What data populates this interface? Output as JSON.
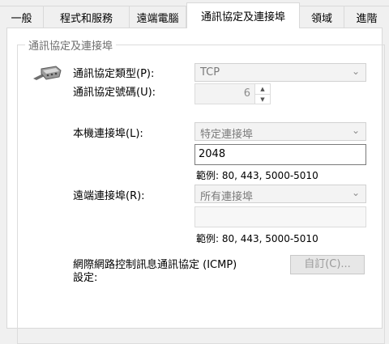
{
  "tabs": [
    "一般",
    "程式和服務",
    "遠端電腦",
    "通訊協定及連接埠",
    "領域",
    "進階"
  ],
  "group_title": "通訊協定及連接埠",
  "protocol_type": {
    "label": "通訊協定類型(P):",
    "value": "TCP"
  },
  "protocol_number": {
    "label": "通訊協定號碼(U):",
    "value": "6"
  },
  "local_port": {
    "label": "本機連接埠(L):",
    "value": "特定連接埠",
    "input_value": "2048",
    "example": "範例: 80, 443, 5000-5010"
  },
  "remote_port": {
    "label": "遠端連接埠(R):",
    "value": "所有連接埠",
    "input_value": "",
    "example": "範例: 80, 443, 5000-5010"
  },
  "icmp": {
    "label_line1": "網際網路控制訊息通訊協定 (ICMP)",
    "label_line2": "設定:",
    "button": "自訂(C)..."
  },
  "icons": {
    "chevron": "chevron-down-icon",
    "connector": "network-connector-icon"
  },
  "colors": {
    "panel": "#ffffff",
    "background": "#f0f0f0",
    "disabled_text": "#7a7a7a",
    "border": "#d9d9d9"
  }
}
